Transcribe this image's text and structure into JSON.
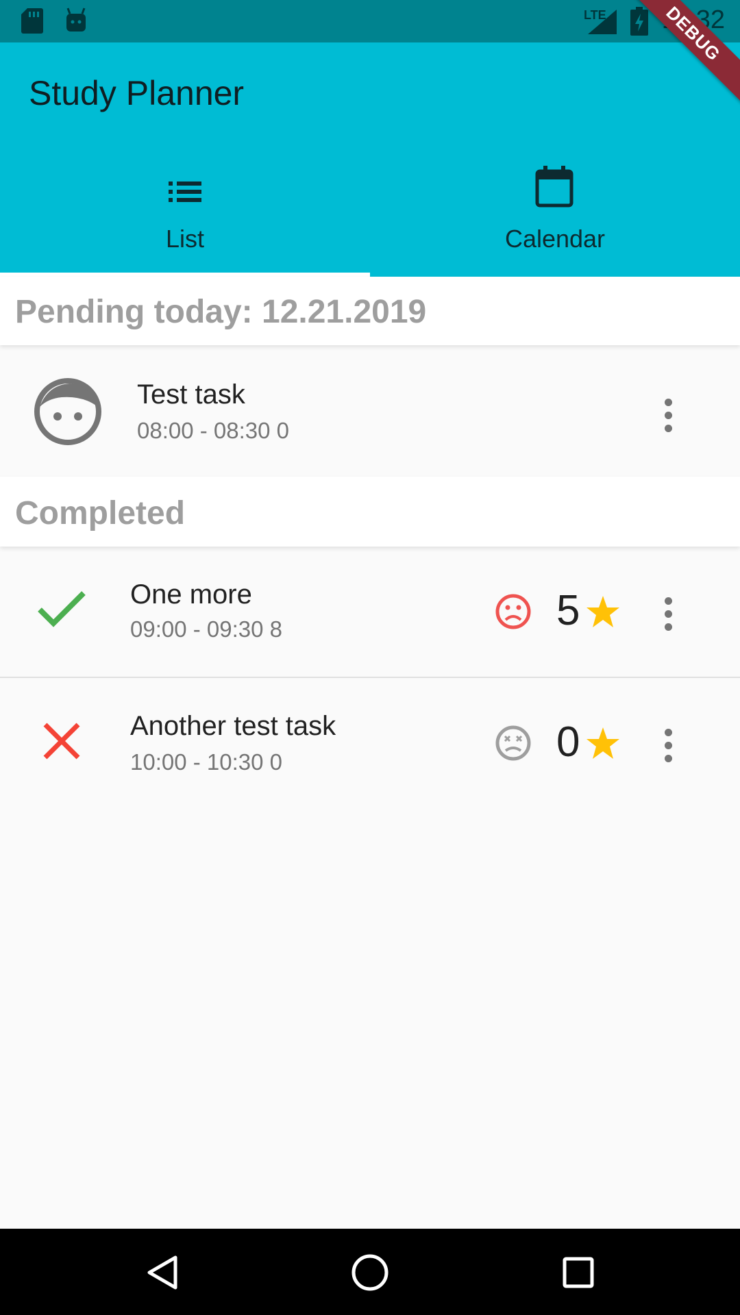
{
  "status_bar": {
    "time": "11:32",
    "network": "LTE"
  },
  "debug_banner": "DEBUG",
  "app_bar": {
    "title": "Study Planner"
  },
  "tabs": [
    {
      "label": "List",
      "icon": "list-icon",
      "selected": true
    },
    {
      "label": "Calendar",
      "icon": "calendar-icon",
      "selected": false
    }
  ],
  "pending": {
    "header": "Pending today: 12.21.2019",
    "tasks": [
      {
        "title": "Test task",
        "subtitle": "08:00 - 08:30 0",
        "icon": "face-icon"
      }
    ]
  },
  "completed": {
    "header": "Completed",
    "tasks": [
      {
        "title": "One more",
        "subtitle": "09:00 - 09:30 8",
        "status_icon": "check-icon",
        "mood_icon": "sad-face-icon",
        "rating": "5"
      },
      {
        "title": "Another test task",
        "subtitle": "10:00 - 10:30 0",
        "status_icon": "close-icon",
        "mood_icon": "dizzy-face-icon",
        "rating": "0"
      }
    ]
  },
  "colors": {
    "app_bar": "#00bcd4",
    "status_bar": "#00838f",
    "check": "#4caf50",
    "cross": "#f44336",
    "sad_face": "#ef5350",
    "star": "#ffc107"
  }
}
